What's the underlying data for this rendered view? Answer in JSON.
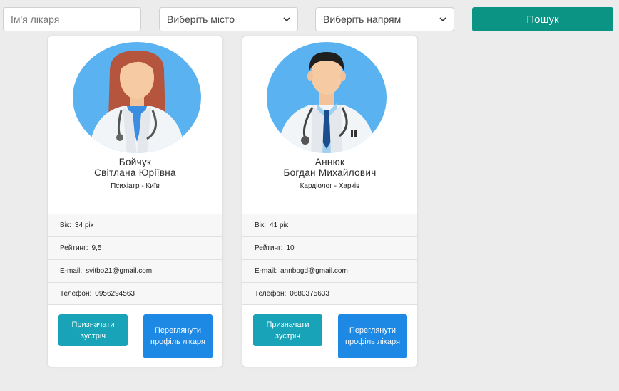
{
  "search": {
    "name_placeholder": "Ім'я лікаря",
    "city_label": "Виберіть місто",
    "direction_label": "Виберіть напрям",
    "submit_label": "Пошук"
  },
  "colors": {
    "search_button": "#0b9383",
    "appoint_button": "#18a3b8",
    "profile_button": "#1e88e5",
    "avatar_bg": "#5ab3f0"
  },
  "doctors": [
    {
      "surname": "Бойчук",
      "given_names": "Світлана Юріївна",
      "specialty_city": "Психіатр - Київ",
      "age_label": "Вік:",
      "age_value": "34 рік",
      "rating_label": "Рейтинг:",
      "rating_value": "9,5",
      "email_label": "E-mail:",
      "email_value": "svitbo21@gmail.com",
      "phone_label": "Телефон:",
      "phone_value": "0956294563",
      "appoint_label": "Призначати зустріч",
      "profile_label": "Переглянути профіль лікаря",
      "avatar_icon": "female-doctor-icon"
    },
    {
      "surname": "Аннюк",
      "given_names": "Богдан Михайлович",
      "specialty_city": "Кардіолог - Харків",
      "age_label": "Вік:",
      "age_value": "41 рік",
      "rating_label": "Рейтинг:",
      "rating_value": "10",
      "email_label": "E-mail:",
      "email_value": "annbogd@gmail.com",
      "phone_label": "Телефон:",
      "phone_value": "0680375633",
      "appoint_label": "Призначати зустріч",
      "profile_label": "Переглянути профіль лікаря",
      "avatar_icon": "male-doctor-icon"
    }
  ]
}
